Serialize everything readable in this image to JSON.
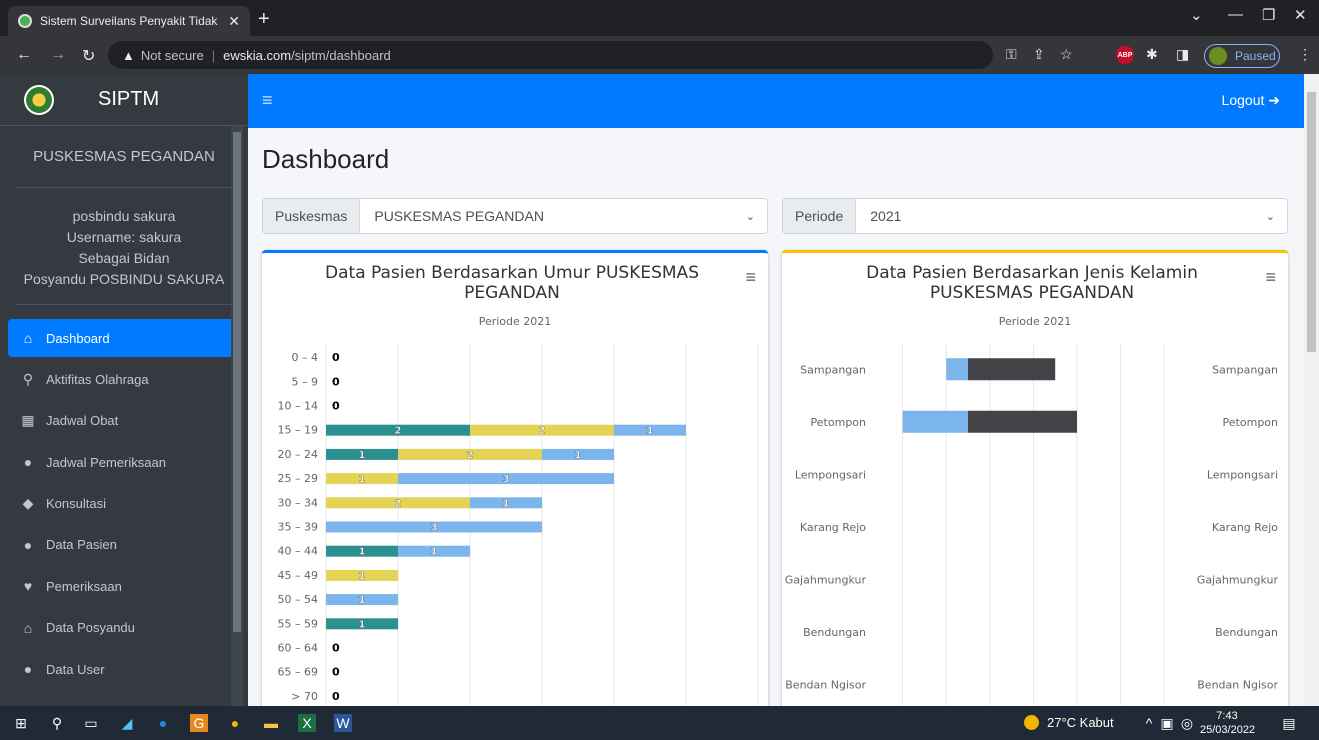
{
  "browser": {
    "tab_title": "Sistem Surveilans Penyakit Tidak",
    "tab_close": "✕",
    "new_tab": "+",
    "security": "Not secure",
    "url_host": "ewskia.com",
    "url_path": "/siptm/dashboard",
    "profile_status": "Paused",
    "abp": "ABP"
  },
  "app": {
    "brand": "SIPTM",
    "puskesmas": "PUSKESMAS PEGANDAN",
    "user_lines": [
      "posbindu sakura",
      "Username: sakura",
      "Sebagai Bidan",
      "Posyandu POSBINDU SAKURA"
    ],
    "menu": [
      {
        "label": "Dashboard",
        "icon": "home-icon",
        "glyph": "⌂",
        "active": true
      },
      {
        "label": "Aktifitas Olahraga",
        "icon": "bicycle-icon",
        "glyph": "⚲"
      },
      {
        "label": "Jadwal Obat",
        "icon": "calendar-icon",
        "glyph": "▦"
      },
      {
        "label": "Jadwal Pemeriksaan",
        "icon": "user-doctor-icon",
        "glyph": "●"
      },
      {
        "label": "Konsultasi",
        "icon": "comments-icon",
        "glyph": "◆"
      },
      {
        "label": "Data Pasien",
        "icon": "users-icon",
        "glyph": "●"
      },
      {
        "label": "Pemeriksaan",
        "icon": "heartbeat-icon",
        "glyph": "♥"
      },
      {
        "label": "Data Posyandu",
        "icon": "house-icon",
        "glyph": "⌂"
      },
      {
        "label": "Data User",
        "icon": "user-icon",
        "glyph": "●"
      }
    ],
    "logout": "Logout",
    "page_title": "Dashboard",
    "filters": {
      "puskesmas_label": "Puskesmas",
      "puskesmas_value": "PUSKESMAS PEGANDAN",
      "periode_label": "Periode",
      "periode_value": "2021"
    }
  },
  "chart_data": [
    {
      "type": "bar",
      "orientation": "horizontal",
      "stacked": true,
      "title": "Data Pasien Berdasarkan Umur PUSKESMAS PEGANDAN",
      "subtitle": "Periode 2021",
      "categories": [
        "0 – 4",
        "5 – 9",
        "10 – 14",
        "15 – 19",
        "20 – 24",
        "25 – 29",
        "30 – 34",
        "35 – 39",
        "40 – 44",
        "45 – 49",
        "50 – 54",
        "55 – 59",
        "60 – 64",
        "65 – 69",
        "> 70"
      ],
      "series": [
        {
          "color": "#2b908f",
          "values": [
            0,
            0,
            0,
            2,
            1,
            0,
            0,
            0,
            1,
            0,
            0,
            1,
            0,
            0,
            0
          ]
        },
        {
          "color": "#e4d354",
          "values": [
            0,
            0,
            0,
            2,
            2,
            1,
            2,
            0,
            0,
            1,
            0,
            0,
            0,
            0,
            0
          ]
        },
        {
          "color": "#f15c80",
          "values": [
            0,
            0,
            0,
            0,
            0,
            0,
            0,
            0,
            0,
            0,
            0,
            0,
            0,
            0,
            0
          ]
        },
        {
          "color": "#7cb5ec",
          "values": [
            0,
            0,
            0,
            1,
            1,
            3,
            1,
            3,
            1,
            0,
            1,
            0,
            0,
            0,
            0
          ]
        }
      ],
      "xlim": [
        0,
        6
      ],
      "grid": true
    },
    {
      "type": "bar",
      "orientation": "horizontal",
      "diverging": true,
      "title": "Data Pasien Berdasarkan Jenis Kelamin PUSKESMAS PEGANDAN",
      "subtitle": "Periode 2021",
      "categories": [
        "Sampangan",
        "Petompon",
        "Lempongsari",
        "Karang Rejo",
        "Gajahmungkur",
        "Bendungan",
        "Bendan Ngisor"
      ],
      "series": [
        {
          "color": "#7cb5ec",
          "side": "left",
          "values": [
            1,
            3,
            0,
            0,
            0,
            0,
            0
          ]
        },
        {
          "color": "#434348",
          "side": "right",
          "values": [
            4,
            5,
            0,
            0,
            0,
            0,
            0
          ]
        }
      ],
      "xlim": [
        -3,
        10
      ],
      "grid": true
    }
  ],
  "taskbar": {
    "weather": "27°C Kabut",
    "time": "7:43",
    "date": "25/03/2022"
  }
}
